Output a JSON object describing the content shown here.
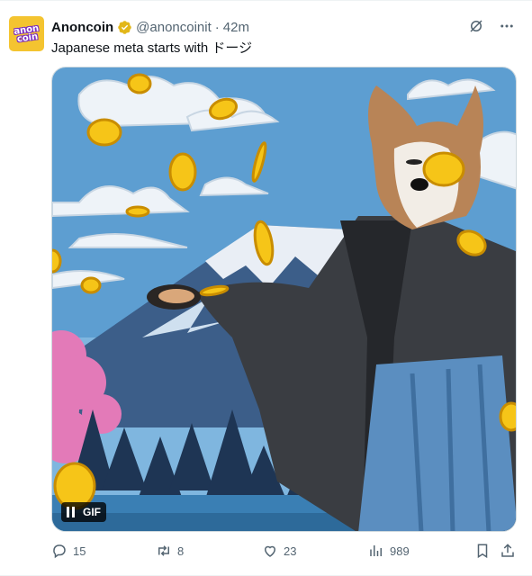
{
  "account": {
    "display_name": "Anoncoin",
    "handle": "@anoncoinit",
    "separator": "·",
    "time": "42m",
    "avatar_text": "anon\ncoin"
  },
  "tweet": {
    "text": "Japanese meta starts with ドージ"
  },
  "media": {
    "badge": "GIF"
  },
  "actions": {
    "replies": "15",
    "reposts": "8",
    "likes": "23",
    "views": "989"
  },
  "colors": {
    "verified": "#e2b719",
    "secondary_text": "#536471",
    "sky": "#5f9fcf",
    "coin": "#f5c518"
  },
  "icons": [
    "verified-badge-icon",
    "grok-icon",
    "more-icon",
    "pause-icon",
    "reply-icon",
    "repost-icon",
    "like-icon",
    "views-icon",
    "bookmark-icon",
    "share-icon"
  ]
}
